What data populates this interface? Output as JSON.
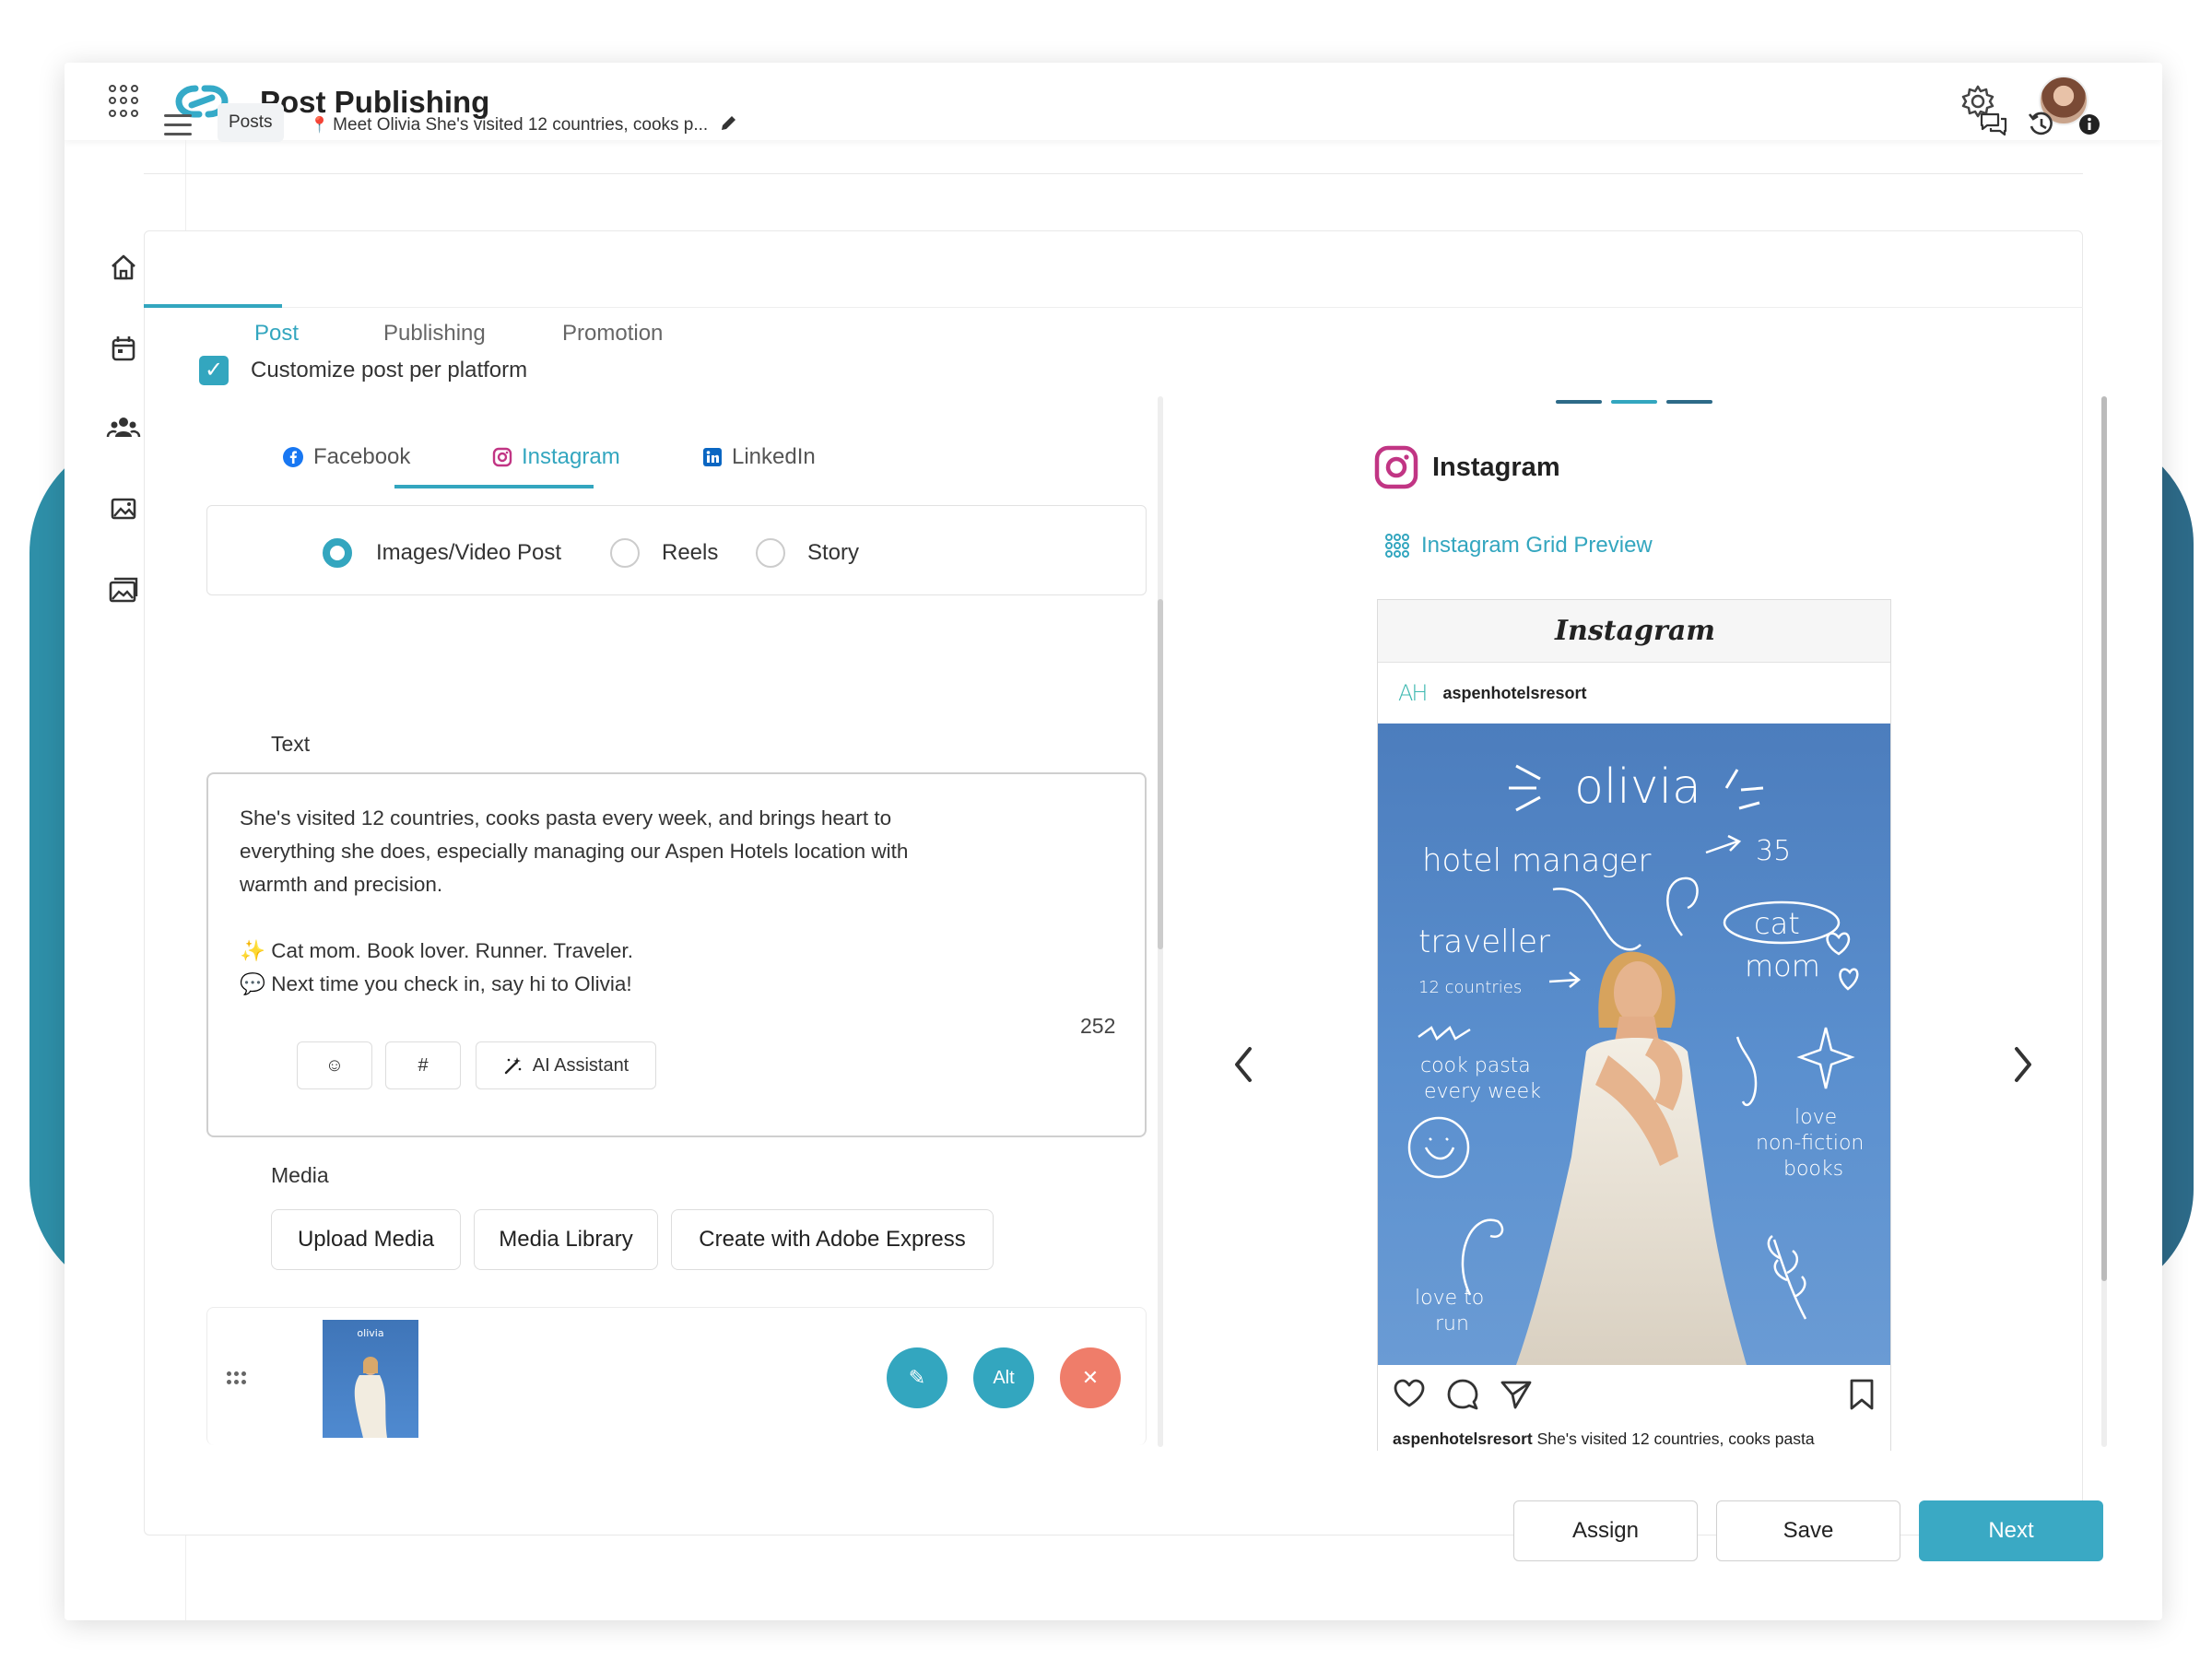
{
  "app": {
    "title": "Post Publishing"
  },
  "breadcrumb": {
    "section": "Posts",
    "post_title": "Meet Olivia She's visited 12 countries, cooks p..."
  },
  "main_tabs": [
    {
      "label": "Post"
    },
    {
      "label": "Publishing"
    },
    {
      "label": "Promotion"
    }
  ],
  "customize": {
    "label": "Customize post per platform",
    "checked": true
  },
  "platform_tabs": [
    {
      "label": "Facebook"
    },
    {
      "label": "Instagram"
    },
    {
      "label": "LinkedIn"
    }
  ],
  "post_types": [
    {
      "label": "Images/Video Post",
      "selected": true
    },
    {
      "label": "Reels",
      "selected": false
    },
    {
      "label": "Story",
      "selected": false
    }
  ],
  "text_section": {
    "label": "Text",
    "body": "She's visited 12 countries, cooks pasta every week, and brings heart to\neverything she does, especially managing our Aspen Hotels location with\nwarmth and precision.\n\n✨ Cat mom. Book lover. Runner. Traveler.\n💬 Next time you check in, say hi to Olivia!",
    "char_count": "252",
    "tools": {
      "emoji": "☺",
      "hashtag": "#",
      "ai": "AI Assistant"
    }
  },
  "media": {
    "label": "Media",
    "buttons": {
      "upload": "Upload Media",
      "library": "Media Library",
      "adobe": "Create with Adobe Express"
    },
    "item_actions": {
      "edit": "✎",
      "alt": "Alt",
      "remove": "✕"
    }
  },
  "preview": {
    "platform": "Instagram",
    "grid_link": "Instagram Grid Preview",
    "app_wordmark": "Instagram",
    "account_initials": "AH",
    "account": "aspenhotelsresort",
    "caption": "She's visited 12 countries, cooks pasta",
    "graphic": {
      "name": "olivia",
      "role": "hotel manager",
      "age": "35",
      "traveller": "traveller",
      "countries": "12 countries",
      "cat": "cat",
      "mom": "mom",
      "cook1": "cook pasta",
      "cook2": "every week",
      "love": "love",
      "nonfiction": "non-fiction",
      "books": "books",
      "run1": "love to",
      "run2": "run"
    }
  },
  "footer": {
    "assign": "Assign",
    "save": "Save",
    "next": "Next"
  },
  "colors": {
    "accent": "#33a6bf",
    "danger": "#ef7d6a",
    "instagram": "#c13584"
  },
  "icons": [
    "apps-grid-icon",
    "link-logo-icon",
    "gear-icon",
    "home-icon",
    "calendar-icon",
    "users-icon",
    "media-icon",
    "gallery-icon",
    "menu-icon",
    "comments-icon",
    "history-icon",
    "info-icon"
  ]
}
